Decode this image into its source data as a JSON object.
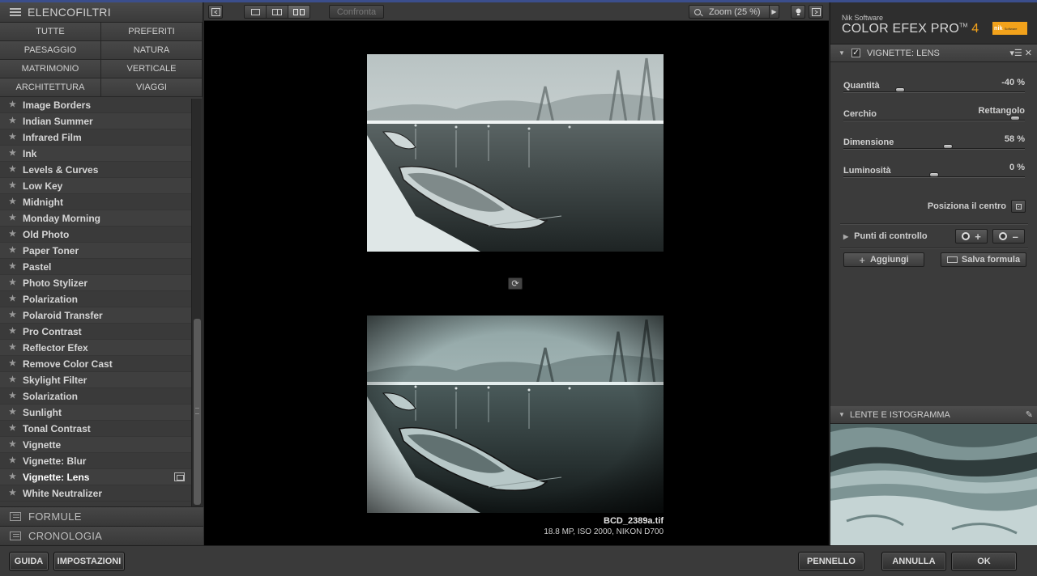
{
  "left_panel": {
    "header": "ELENCOFILTRI",
    "categories": [
      "TUTTE",
      "PREFERITI",
      "PAESAGGIO",
      "NATURA",
      "MATRIMONIO",
      "VERTICALE",
      "ARCHITETTURA",
      "VIAGGI"
    ],
    "filters": [
      "Image Borders",
      "Indian Summer",
      "Infrared Film",
      "Ink",
      "Levels & Curves",
      "Low Key",
      "Midnight",
      "Monday Morning",
      "Old Photo",
      "Paper Toner",
      "Pastel",
      "Photo Stylizer",
      "Polarization",
      "Polaroid Transfer",
      "Pro Contrast",
      "Reflector Efex",
      "Remove Color Cast",
      "Skylight Filter",
      "Solarization",
      "Sunlight",
      "Tonal Contrast",
      "Vignette",
      "Vignette: Blur",
      "Vignette: Lens",
      "White Neutralizer"
    ],
    "selected_filter": "Vignette: Lens",
    "sections": {
      "formule": "FORMULE",
      "cronologia": "CRONOLOGIA"
    }
  },
  "toolbar": {
    "compare_label": "Confronta",
    "zoom_label": "Zoom (25 %)"
  },
  "preview": {
    "file_name": "BCD_2389a.tif",
    "file_meta": "18.8 MP, ISO 2000, NIKON D700"
  },
  "right_panel": {
    "brand_small": "Nik Software",
    "brand_name": "COLOR EFEX PRO",
    "brand_tm": "TM",
    "brand_version": "4",
    "logo_text": "nik",
    "logo_sub": "Software",
    "filter_header": "VIGNETTE: LENS",
    "params": [
      {
        "label": "Quantità",
        "value": "-40 %",
        "level": -40
      },
      {
        "label": "Cerchio",
        "value": "Rettangolo"
      },
      {
        "label": "Dimensione",
        "value": "58 %",
        "level": 58
      },
      {
        "label": "Luminosità",
        "value": "0 %",
        "level": 0
      }
    ],
    "center_label": "Posiziona il centro",
    "control_points_label": "Punti di controllo",
    "add_label": "Aggiungi",
    "save_label": "Salva formula",
    "loupe_header": "LENTE E ISTOGRAMMA"
  },
  "bottom_bar": {
    "guide": "GUIDA",
    "settings": "IMPOSTAZIONI",
    "brush": "PENNELLO",
    "cancel": "ANNULLA",
    "ok": "OK"
  },
  "colors": {
    "accent_orange": "#f2a21b",
    "panel_bg": "#3a3a3a",
    "canvas_bg": "#000000",
    "top_line": "#3b4e8c"
  }
}
